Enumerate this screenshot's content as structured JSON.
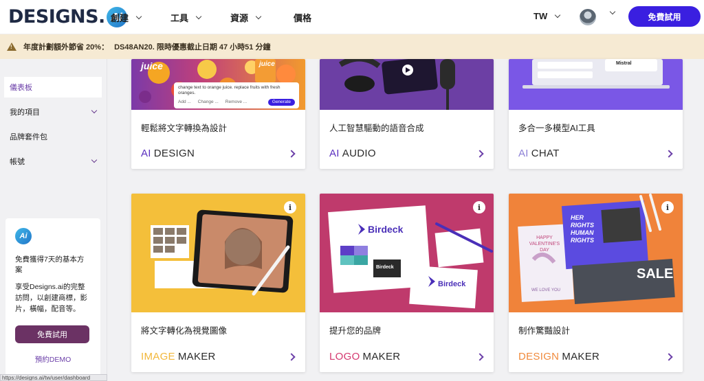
{
  "brand": {
    "name": "DESIGNS.",
    "badge": "Ai"
  },
  "nav": {
    "items": [
      {
        "label": "創建",
        "has_dropdown": true
      },
      {
        "label": "工具",
        "has_dropdown": true
      },
      {
        "label": "資源",
        "has_dropdown": true
      },
      {
        "label": "價格",
        "has_dropdown": false
      }
    ],
    "language": "TW",
    "cta": "免費試用"
  },
  "banner": {
    "text": "年度計劃額外節省 20%：",
    "code": "DS48AN20. 限時優惠截止日期 47 小時51 分鐘",
    "icon": "warning-icon"
  },
  "sidebar": {
    "items": [
      {
        "label": "儀表板",
        "active": true,
        "has_dropdown": false
      },
      {
        "label": "我的項目",
        "active": false,
        "has_dropdown": true
      },
      {
        "label": "品牌套件包",
        "active": false,
        "has_dropdown": false
      },
      {
        "label": "帳號",
        "active": false,
        "has_dropdown": true
      }
    ],
    "trial": {
      "title": "免費獲得7天的基本方案",
      "desc": "享受Designs.ai的完整訪問，以創建商標，影片，橫幅，配音等。",
      "button": "免費試用",
      "demo": "預約DEMO"
    }
  },
  "statusbar": "https://designs.ai/tw/user/dashboard",
  "cards": [
    {
      "desc": "輕鬆將文字轉換為設計",
      "accent": "AI",
      "product": "DESIGN",
      "accent_color": "#5a2fbf"
    },
    {
      "desc": "人工智慧驅動的語音合成",
      "accent": "AI",
      "product": "AUDIO",
      "accent_color": "#5a2fbf"
    },
    {
      "desc": "多合一多模型AI工具",
      "accent": "AI",
      "product": "CHAT",
      "accent_color": "#8b7fd6"
    },
    {
      "desc": "將文字轉化為視覺圖像",
      "accent": "IMAGE",
      "product": "MAKER",
      "accent_color": "#f2b73a"
    },
    {
      "desc": "提升您的品牌",
      "accent": "LOGO",
      "product": "MAKER",
      "accent_color": "#d4386f"
    },
    {
      "desc": "制作驚豔設計",
      "accent": "DESIGN",
      "product": "MAKER",
      "accent_color": "#f08a3c"
    }
  ],
  "art": {
    "juice_prompt": "change text to orange juice. replace fruits with fresh oranges.",
    "juice_opts": [
      "Add ...",
      "Change ...",
      "Remove ..."
    ],
    "juice_generate": "Generate",
    "juice_word": "juice",
    "mistral": "Mistral",
    "birdeck": "Birdeck",
    "sale": "SALE",
    "her_rights": "HER RIGHTS HUMAN RIGHTS",
    "valentine": "HAPPY VALENTINE'S DAY",
    "we_love_you": "WE LOVE YOU"
  }
}
